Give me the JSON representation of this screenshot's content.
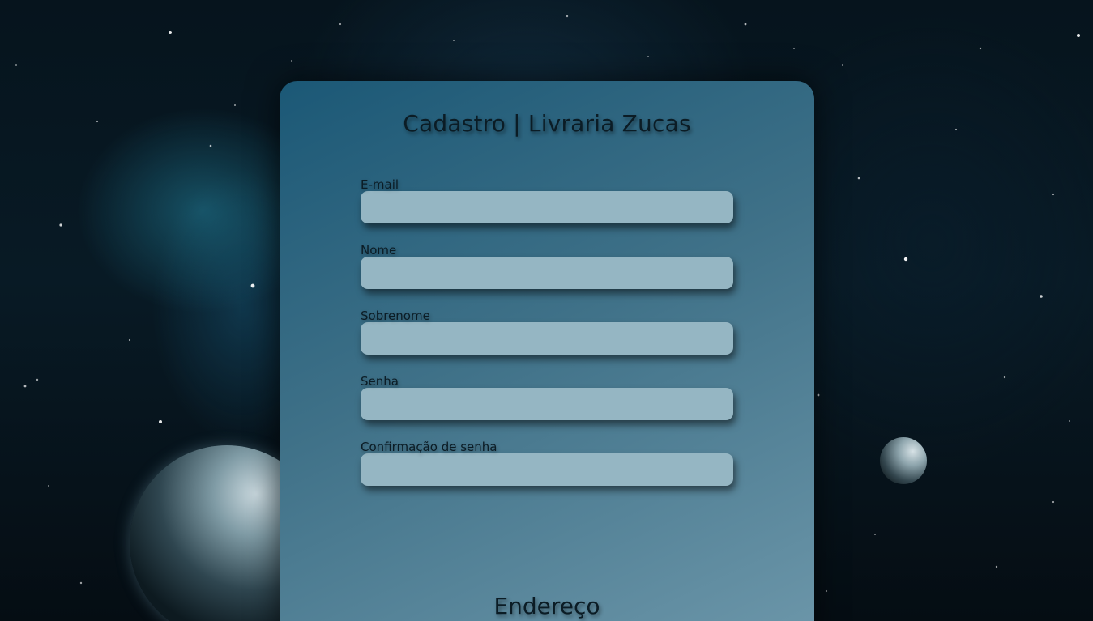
{
  "page": {
    "title": "Cadastro | Livraria Zucas"
  },
  "form": {
    "fields": [
      {
        "label": "E-mail",
        "value": "",
        "placeholder": ""
      },
      {
        "label": "Nome",
        "value": "",
        "placeholder": ""
      },
      {
        "label": "Sobrenome",
        "value": "",
        "placeholder": ""
      },
      {
        "label": "Senha",
        "value": "",
        "placeholder": ""
      },
      {
        "label": "Confirmação de senha",
        "value": "",
        "placeholder": ""
      }
    ]
  },
  "address_section": {
    "title": "Endereço"
  },
  "colors": {
    "card_gradient_start": "#1b5876",
    "card_gradient_end": "#6d97aa",
    "input_background": "#95b6c3",
    "text": "#0b1c25"
  }
}
